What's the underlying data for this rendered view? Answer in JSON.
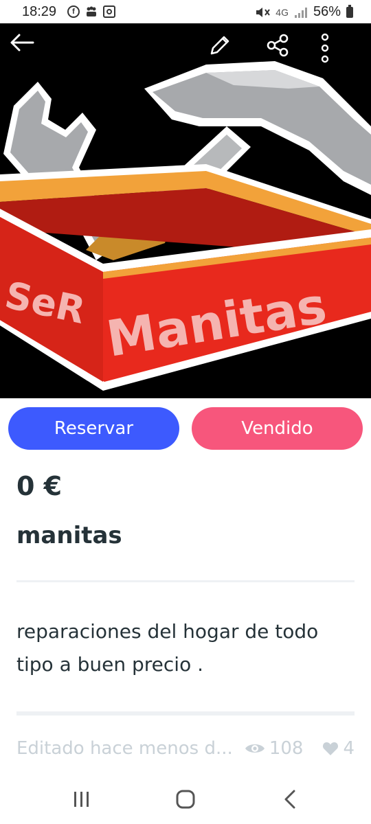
{
  "status_bar": {
    "time": "18:29",
    "left_icons": [
      "facebook-icon",
      "group-icon",
      "instagram-icon"
    ],
    "network": "4G",
    "battery": "56%"
  },
  "hero": {
    "logo_text_1": "SeR",
    "logo_text_2": "Manitas",
    "colors": {
      "box_red": "#E8291D",
      "box_orange": "#F2A23A",
      "steel": "#A7A9AC"
    }
  },
  "toolbar": {
    "back_icon": "back-arrow-icon",
    "edit_icon": "pencil-icon",
    "share_icon": "share-icon",
    "more_icon": "more-vertical-icon"
  },
  "actions": {
    "reserve_label": "Reservar",
    "sold_label": "Vendido",
    "colors": {
      "reserve": "#3D5AFE",
      "sold": "#F7567C"
    }
  },
  "listing": {
    "price": "0 €",
    "title": "manitas",
    "description": "reparaciones del hogar de todo tipo a buen precio .",
    "edited": "Editado hace menos d...",
    "views": "108",
    "likes": "4"
  },
  "nav": {
    "recents_icon": "recents-icon",
    "home_icon": "home-icon",
    "back_icon": "back-icon"
  }
}
